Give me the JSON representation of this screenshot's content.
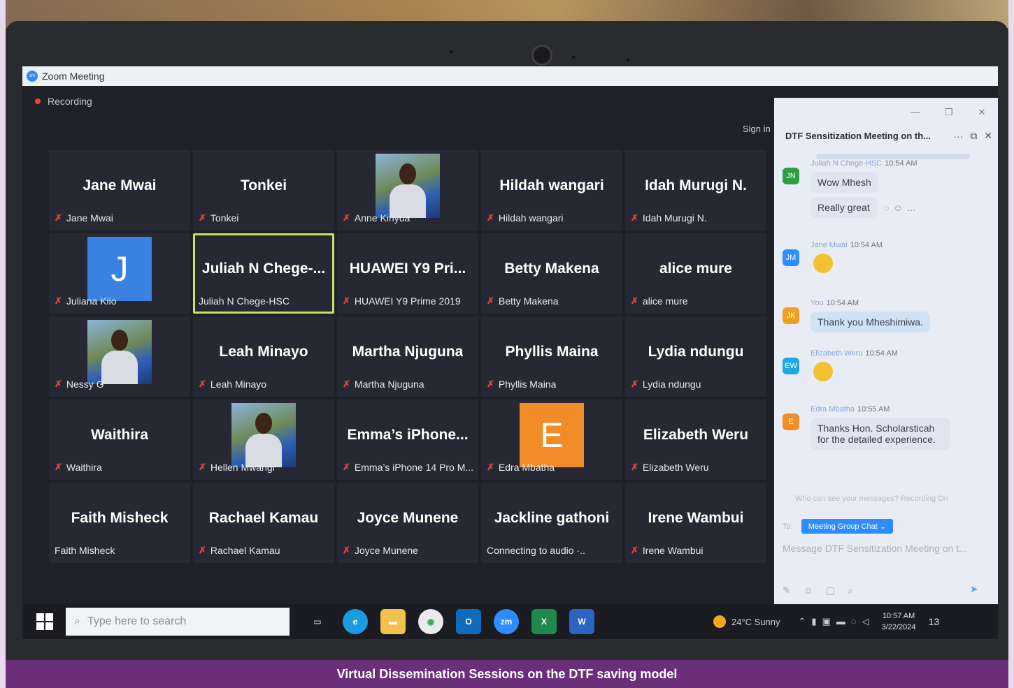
{
  "window": {
    "app_title": "Zoom Meeting",
    "recording_label": "Recording",
    "sign_in": "Sign in"
  },
  "window_controls": {
    "minimize": "—",
    "restore": "❐",
    "close": "✕"
  },
  "gallery": {
    "tiles": [
      {
        "big": "Jane Mwai",
        "label": "Jane Mwai",
        "muted": true,
        "kind": "name"
      },
      {
        "big": "Tonkei",
        "label": "Tonkei",
        "muted": true,
        "kind": "name"
      },
      {
        "big": "",
        "label": "Anne Kinyua",
        "muted": true,
        "kind": "photo"
      },
      {
        "big": "Hildah wangari",
        "label": "Hildah wangari",
        "muted": true,
        "kind": "name"
      },
      {
        "big": "Idah Murugi N.",
        "label": "Idah Murugi N.",
        "muted": true,
        "kind": "name"
      },
      {
        "big": "J",
        "label": "Juliana Kiio",
        "muted": true,
        "kind": "letter",
        "color": "#3b82e0"
      },
      {
        "big": "Juliah N Chege-...",
        "label": "Juliah N Chege-HSC",
        "muted": false,
        "kind": "name",
        "active": true
      },
      {
        "big": "HUAWEI Y9 Pri...",
        "label": "HUAWEI Y9 Prime 2019",
        "muted": true,
        "kind": "name"
      },
      {
        "big": "Betty Makena",
        "label": "Betty Makena",
        "muted": true,
        "kind": "name"
      },
      {
        "big": "alice mure",
        "label": "alice mure",
        "muted": true,
        "kind": "name"
      },
      {
        "big": "",
        "label": "Nessy G",
        "muted": true,
        "kind": "photo"
      },
      {
        "big": "Leah Minayo",
        "label": "Leah Minayo",
        "muted": true,
        "kind": "name"
      },
      {
        "big": "Martha Njuguna",
        "label": "Martha Njuguna",
        "muted": true,
        "kind": "name"
      },
      {
        "big": "Phyllis Maina",
        "label": "Phyllis Maina",
        "muted": true,
        "kind": "name"
      },
      {
        "big": "Lydia ndungu",
        "label": "Lydia ndungu",
        "muted": true,
        "kind": "name"
      },
      {
        "big": "Waithira",
        "label": "Waithira",
        "muted": true,
        "kind": "name"
      },
      {
        "big": "",
        "label": "Hellen Mwangi",
        "muted": true,
        "kind": "photo"
      },
      {
        "big": "Emma’s iPhone...",
        "label": "Emma’s iPhone 14 Pro M...",
        "muted": true,
        "kind": "name"
      },
      {
        "big": "E",
        "label": "Edra Mbatha",
        "muted": true,
        "kind": "letter",
        "color": "#f28c28"
      },
      {
        "big": "Elizabeth Weru",
        "label": "Elizabeth Weru",
        "muted": true,
        "kind": "name"
      },
      {
        "big": "Faith Misheck",
        "label": "Faith Misheck",
        "muted": false,
        "kind": "name"
      },
      {
        "big": "Rachael Kamau",
        "label": "Rachael Kamau",
        "muted": true,
        "kind": "name"
      },
      {
        "big": "Joyce Munene",
        "label": "Joyce Munene",
        "muted": true,
        "kind": "name"
      },
      {
        "big": "Jackline gathoni",
        "label": "Connecting to audio ·..",
        "muted": false,
        "kind": "name"
      },
      {
        "big": "Irene Wambui",
        "label": "Irene Wambui",
        "muted": true,
        "kind": "name"
      }
    ]
  },
  "chat": {
    "title": "DTF Sensitization Meeting on th...",
    "more_icon": "···",
    "popout_icon": "⧉",
    "close_icon": "✕",
    "messages": [
      {
        "initials": "JN",
        "color": "#2ea043",
        "sender": "Juliah N Chege-HSC",
        "time": "10:54 AM",
        "texts": [
          "Wow Mhesh",
          "Really great"
        ]
      },
      {
        "initials": "JM",
        "color": "#2d8cff",
        "sender": "Jane Mwai",
        "time": "10:54 AM",
        "emoji": true
      },
      {
        "initials": "JK",
        "color": "#f0a020",
        "sender": "You",
        "time": "10:54 AM",
        "texts": [
          "Thank you Mheshimiwa."
        ],
        "mine": true
      },
      {
        "initials": "EW",
        "color": "#1ea7e0",
        "sender": "Elizabeth Weru",
        "time": "10:54 AM",
        "emoji": true
      },
      {
        "initials": "E",
        "color": "#f28c28",
        "sender": "Edra Mbatha",
        "time": "10:55 AM",
        "texts": [
          "Thanks Hon. Scholarsticah for the detailed experience."
        ]
      }
    ],
    "privacy_note": "Who can see your messages? Recording On",
    "to_label": "To:",
    "to_target": "Meeting Group Chat ⌄",
    "compose_placeholder": "Message DTF Sensitization Meeting on t..."
  },
  "taskbar": {
    "search_placeholder": "Type here to search",
    "weather": "24°C  Sunny",
    "time": "10:57 AM",
    "date": "3/22/2024",
    "notifications": "13"
  },
  "caption": "Virtual Dissemination Sessions on the DTF saving model"
}
